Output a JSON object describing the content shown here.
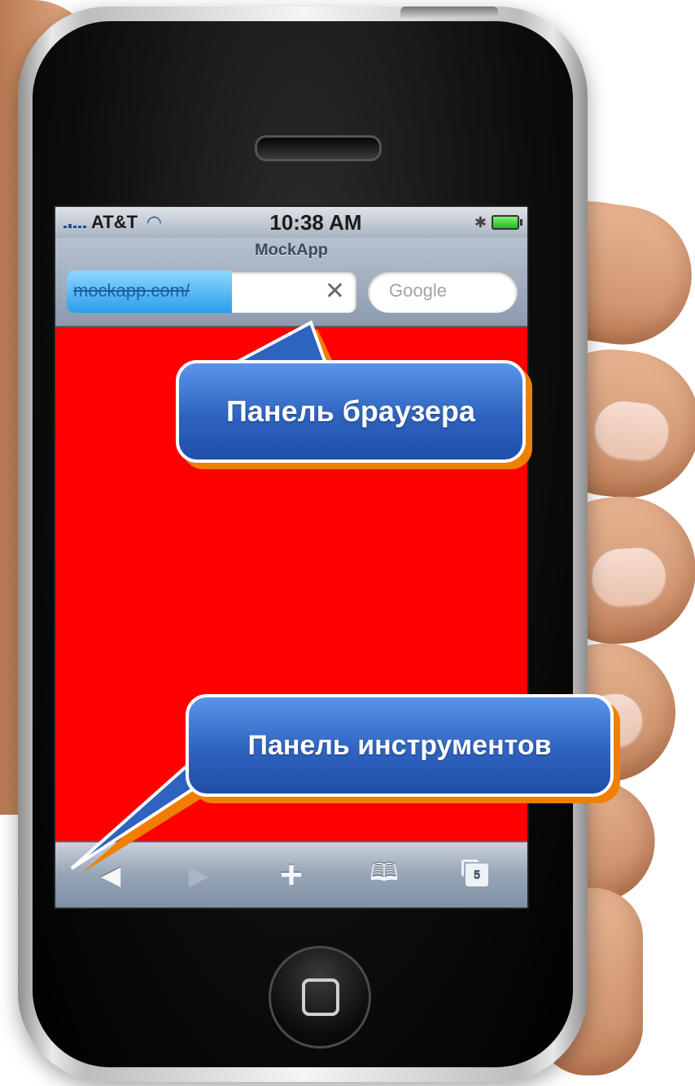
{
  "status_bar": {
    "carrier": "AT&T",
    "time": "10:38 AM"
  },
  "browser": {
    "title": "MockApp",
    "url": "mockapp.com/",
    "load_progress": 0.57,
    "search_placeholder": "Google"
  },
  "toolbar": {
    "buttons": [
      "back",
      "forward",
      "add",
      "bookmarks",
      "pages"
    ],
    "pages_count": "5"
  },
  "callouts": {
    "browser_bar": "Панель браузера",
    "toolbar": "Панель инструментов"
  },
  "colors": {
    "screen_background": "#ff0000",
    "callout_fill": "#2f63c0",
    "callout_shadow": "#f07f00"
  }
}
